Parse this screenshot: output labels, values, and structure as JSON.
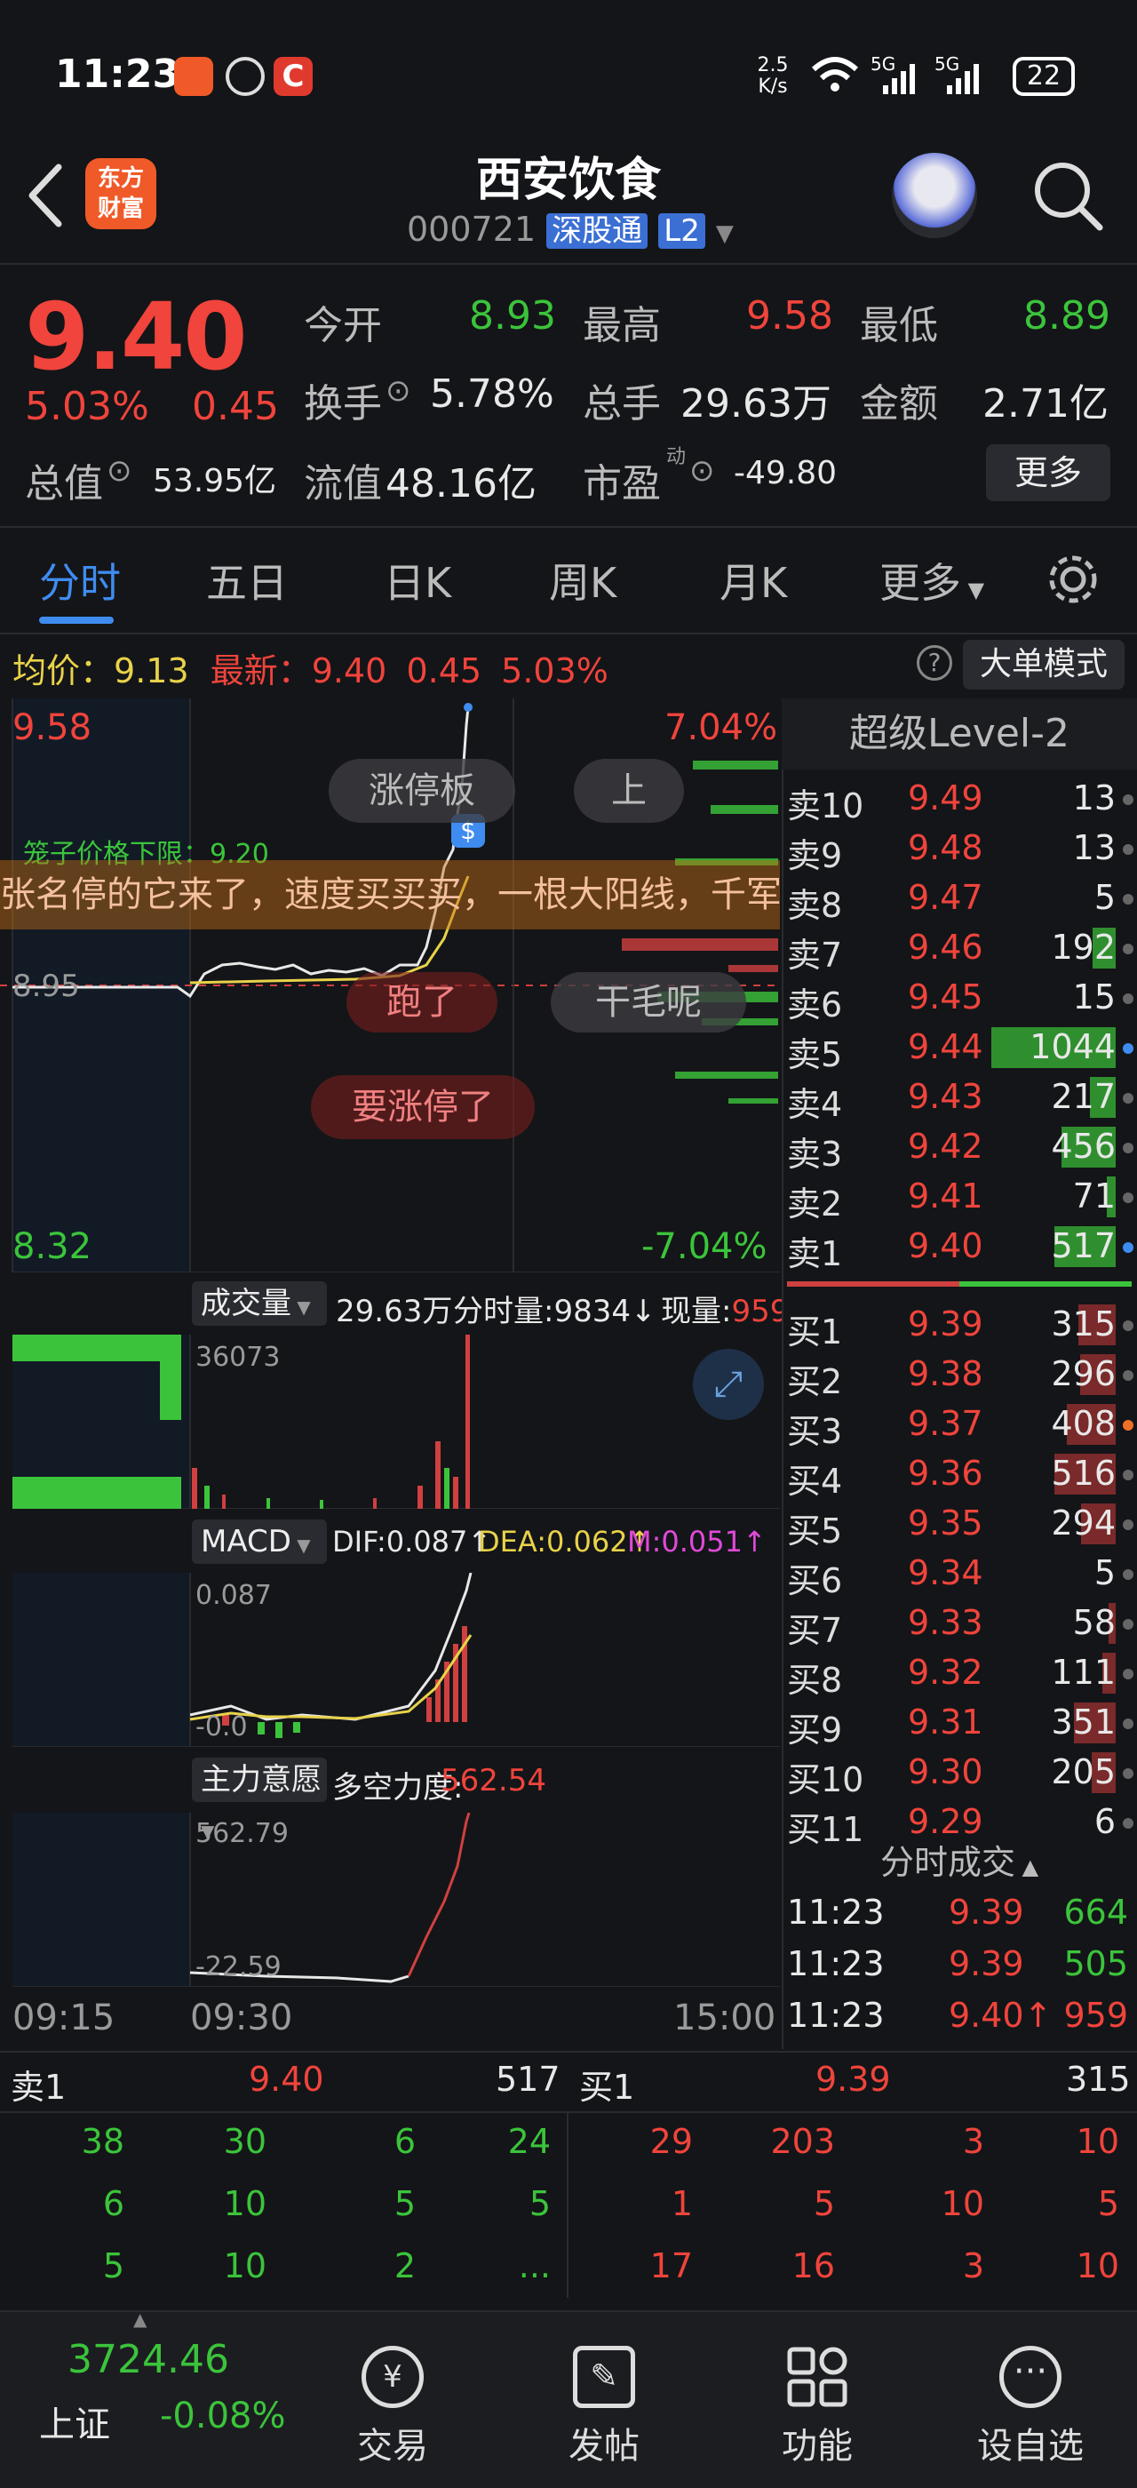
{
  "status": {
    "time": "11:23",
    "net_speed": "2.5 K/s",
    "signal1": "5G",
    "signal2": "5G",
    "battery": "22"
  },
  "header": {
    "back_icon": "chevron-left-icon",
    "logo_line1": "东方",
    "logo_line2": "财富",
    "stock_name": "西安饮食",
    "stock_code": "000721",
    "market_badge": "深股通",
    "level_badge": "L2"
  },
  "quote": {
    "price": "9.40",
    "change_pct": "5.03%",
    "change": "0.45",
    "open_label": "今开",
    "open": "8.93",
    "high_label": "最高",
    "high": "9.58",
    "low_label": "最低",
    "low": "8.89",
    "turnover_label": "换手",
    "turnover": "5.78%",
    "volume_label": "总手",
    "volume": "29.63万",
    "amount_label": "金额",
    "amount": "2.71亿",
    "mktcap_label": "总值",
    "mktcap": "53.95亿",
    "float_label": "流值",
    "float": "48.16亿",
    "pe_label": "市盈",
    "pe_sup": "动",
    "pe": "-49.80",
    "more": "更多"
  },
  "tabs": [
    "分时",
    "五日",
    "日K",
    "周K",
    "月K",
    "更多"
  ],
  "infobar": {
    "avg_label": "均价：",
    "avg": "9.13",
    "latest_label": "最新：",
    "latest": "9.40",
    "latest_chg": "0.45",
    "latest_pct": "5.03%",
    "mode_btn": "大单模式"
  },
  "chart": {
    "price_top": "9.58",
    "price_bottom": "8.32",
    "pct_top": "7.04%",
    "pct_bottom": "-7.04%",
    "cage_label": "笼子价格下限：9.20",
    "ref_price": "8.95",
    "time_start": "09:15",
    "time_open": "09:30",
    "time_end": "15:00"
  },
  "danmu": {
    "d1": "涨停板",
    "d2": "上",
    "marquee": "张名停的它来了，速度买买买，一根大阳线，千军",
    "d3": "跑了",
    "d4": "干毛呢",
    "d5": "要涨停了"
  },
  "volume_panel": {
    "selector": "成交量",
    "total": "29.63万",
    "minute_vol": "分时量:9834↓",
    "now_vol_label": "现量:",
    "now_vol": "959",
    "max": "36073"
  },
  "macd_panel": {
    "selector": "MACD",
    "dif": "DIF:0.087↑",
    "dea": "DEA:0.062↑",
    "m": "M:0.051↑",
    "max": "0.087",
    "min": "-0.0"
  },
  "force_panel": {
    "selector": "主力意愿",
    "label": "多空力度:",
    "value": "562.54",
    "max": "562.79",
    "min": "-22.59"
  },
  "orderbook": {
    "title": "超级Level-2",
    "asks": [
      {
        "label": "卖10",
        "price": "9.49",
        "vol": "13"
      },
      {
        "label": "卖9",
        "price": "9.48",
        "vol": "13"
      },
      {
        "label": "卖8",
        "price": "9.47",
        "vol": "5"
      },
      {
        "label": "卖7",
        "price": "9.46",
        "vol": "192"
      },
      {
        "label": "卖6",
        "price": "9.45",
        "vol": "15"
      },
      {
        "label": "卖5",
        "price": "9.44",
        "vol": "1044"
      },
      {
        "label": "卖4",
        "price": "9.43",
        "vol": "217"
      },
      {
        "label": "卖3",
        "price": "9.42",
        "vol": "456"
      },
      {
        "label": "卖2",
        "price": "9.41",
        "vol": "71"
      },
      {
        "label": "卖1",
        "price": "9.40",
        "vol": "517"
      }
    ],
    "bids": [
      {
        "label": "买1",
        "price": "9.39",
        "vol": "315"
      },
      {
        "label": "买2",
        "price": "9.38",
        "vol": "296"
      },
      {
        "label": "买3",
        "price": "9.37",
        "vol": "408"
      },
      {
        "label": "买4",
        "price": "9.36",
        "vol": "516"
      },
      {
        "label": "买5",
        "price": "9.35",
        "vol": "294"
      },
      {
        "label": "买6",
        "price": "9.34",
        "vol": "5"
      },
      {
        "label": "买7",
        "price": "9.33",
        "vol": "58"
      },
      {
        "label": "买8",
        "price": "9.32",
        "vol": "111"
      },
      {
        "label": "买9",
        "price": "9.31",
        "vol": "351"
      },
      {
        "label": "买10",
        "price": "9.30",
        "vol": "205"
      },
      {
        "label": "买11",
        "price": "9.29",
        "vol": "6"
      }
    ],
    "trades_title": "分时成交",
    "trades": [
      {
        "time": "11:23",
        "price": "9.39",
        "vol": "664"
      },
      {
        "time": "11:23",
        "price": "9.39",
        "vol": "505"
      },
      {
        "time": "11:23",
        "price": "9.40↑",
        "vol": "959"
      }
    ]
  },
  "queue": {
    "ask_label": "卖1",
    "ask_price": "9.40",
    "ask_vol": "517",
    "bid_label": "买1",
    "bid_price": "9.39",
    "bid_vol": "315",
    "ask_rows": [
      [
        "38",
        "30",
        "6",
        "24"
      ],
      [
        "6",
        "10",
        "5",
        "5"
      ],
      [
        "5",
        "10",
        "2",
        "..."
      ]
    ],
    "bid_rows": [
      [
        "29",
        "203",
        "3",
        "10"
      ],
      [
        "1",
        "5",
        "10",
        "5"
      ],
      [
        "17",
        "16",
        "3",
        "10"
      ]
    ]
  },
  "bottomnav": {
    "index_value": "3724.46",
    "index_name": "上证",
    "index_change": "-0.08%",
    "trade": "交易",
    "post": "发帖",
    "function": "功能",
    "watch": "设自选"
  }
}
